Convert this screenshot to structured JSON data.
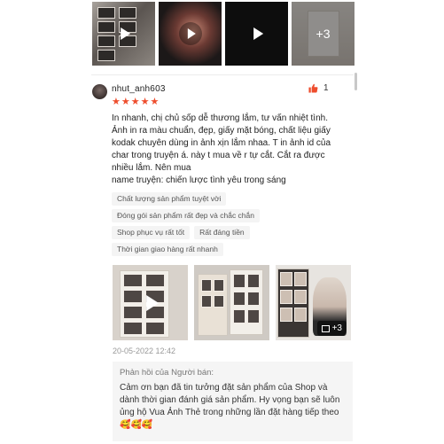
{
  "top_media": {
    "items": [
      {
        "kind": "video",
        "icon": "play-icon"
      },
      {
        "kind": "video",
        "icon": "play-icon"
      },
      {
        "kind": "video",
        "icon": "play-icon"
      },
      {
        "kind": "image",
        "overlay": "+3"
      }
    ]
  },
  "review": {
    "username": "nhut_anh603",
    "like_count": "1",
    "like_icon": "thumbs-up-icon",
    "rating": 5,
    "star_char": "★",
    "body": "In nhanh, chị chủ sốp dễ thương lắm, tư vấn nhiệt tình.\nẢnh in ra màu chuẩn, đẹp, giấy mặt bóng, chất liệu giấy\nkodak chuyên dùng in ảnh xịn lắm nhaa. T in ảnh id của\nchar trong truyện á.  này t mua về r tự cắt. Cắt ra được\nnhiều lắm. Nên mua\nname truyện: chiến lược tình yêu trong sáng",
    "tags": [
      [
        "Chất lượng sản phẩm tuyệt vời"
      ],
      [
        "Đóng gói sản phẩm rất đẹp và chắc chắn"
      ],
      [
        "Shop phục vụ rất tốt",
        "Rất đáng tiền"
      ],
      [
        "Thời gian giao hàng rất nhanh"
      ]
    ],
    "photos_more": "+3",
    "date": "20-05-2022 12:42"
  },
  "reply": {
    "title": "Phản hồi của Người bán:",
    "text": "Cảm ơn bạn đã tin tưởng đặt sản phẩm của Shop và dành thời gian đánh giá sản phẩm. Hy vọng bạn sẽ luôn ủng hộ Vua Ảnh Thẻ trong những lần đặt hàng tiếp theo 🥰🥰🥰"
  },
  "colors": {
    "accent": "#ee4d2d",
    "muted": "#999999",
    "tag_bg": "#f4f4f4",
    "reply_bg": "#f5f5f5"
  }
}
